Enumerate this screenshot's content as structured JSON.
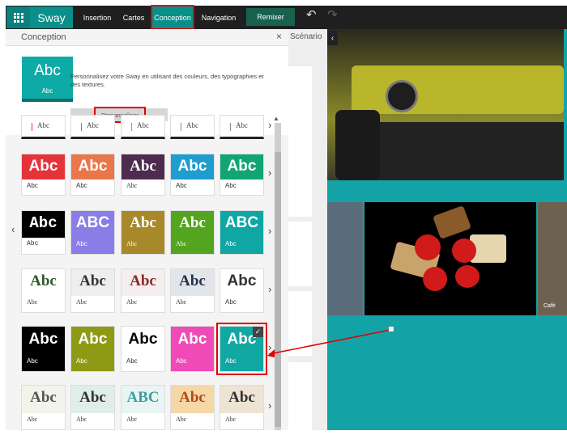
{
  "app": {
    "brand": "Sway",
    "menu_icon": "grid-icon"
  },
  "nav": {
    "tabs": [
      {
        "label": "Insertion"
      },
      {
        "label": "Cartes"
      },
      {
        "label": "Conception"
      },
      {
        "label": "Navigation"
      }
    ],
    "remix": "Remixer",
    "undo_icon": "undo-icon",
    "redo_icon": "redo-icon"
  },
  "pane": {
    "title": "Conception",
    "close": "×",
    "customize": {
      "sample_big": "Abc",
      "sample_small": "Abc",
      "description": "Personnalisez votre Sway en utilisant des couleurs, des typographies et des textures.",
      "button": "Personnaliser"
    },
    "theme_rows": [
      {
        "tiles": [
          "Abc",
          "Abc",
          "Abc",
          "Abc",
          "Abc"
        ]
      },
      {
        "tiles": [
          "Abc",
          "Abc",
          "Abc",
          "Abc",
          "Abc"
        ]
      },
      {
        "tiles": [
          "Abc",
          "ABC",
          "Abc",
          "Abc",
          "ABC"
        ]
      },
      {
        "tiles": [
          "Abc",
          "Abc",
          "Abc",
          "Abc",
          "Abc"
        ]
      },
      {
        "tiles": [
          "Abc",
          "Abc",
          "Abc",
          "Abc",
          "Abc"
        ]
      },
      {
        "tiles": [
          "Abc",
          "Abc",
          "ABC",
          "Abc",
          "Abc"
        ]
      }
    ],
    "selected_check": "✓"
  },
  "storyline": {
    "label": "Scénario"
  },
  "preview": {
    "caption": "Café"
  },
  "colors": {
    "accent": "#0a8f8b",
    "highlight": "#e00000",
    "preview_bg": "#13a3a6"
  }
}
